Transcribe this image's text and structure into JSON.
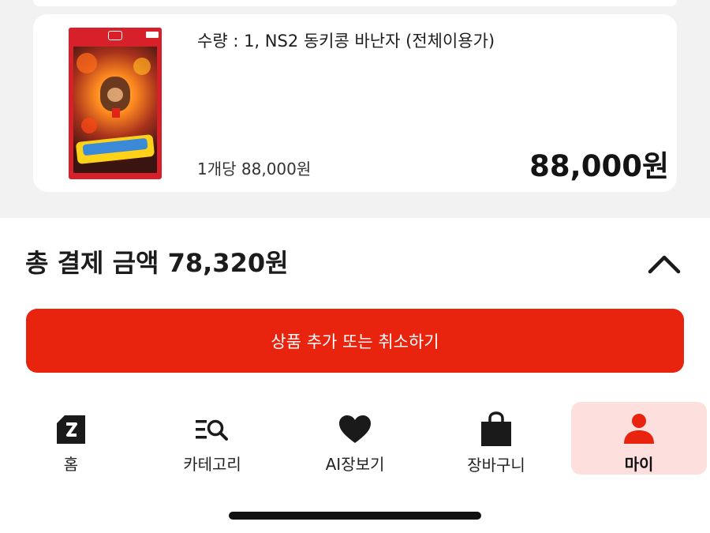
{
  "order_item": {
    "title": "수량 : 1,  NS2 동키콩 바난자 (전체이용가)",
    "unit_price": "1개당 88,000원",
    "line_total": "88,000원",
    "box_art": {
      "platform_mark": "2",
      "game_logo": "DONKEY KONG BANANZA"
    }
  },
  "summary": {
    "total_label": "총 결제 금액 78,320원",
    "toggle_icon": "chevron-up-icon"
  },
  "primary_action": {
    "label": "상품 추가 또는 취소하기",
    "color": "#e8230e"
  },
  "bottom_nav": {
    "items": [
      {
        "label": "홈",
        "icon": "home-icon",
        "active": false
      },
      {
        "label": "카테고리",
        "icon": "category-search-icon",
        "active": false
      },
      {
        "label": "AI장보기",
        "icon": "heart-icon",
        "active": false
      },
      {
        "label": "장바구니",
        "icon": "shopping-bag-icon",
        "active": false
      },
      {
        "label": "마이",
        "icon": "user-icon",
        "active": true
      }
    ],
    "active_color": "#e8230e",
    "active_bg": "#fde0de"
  }
}
